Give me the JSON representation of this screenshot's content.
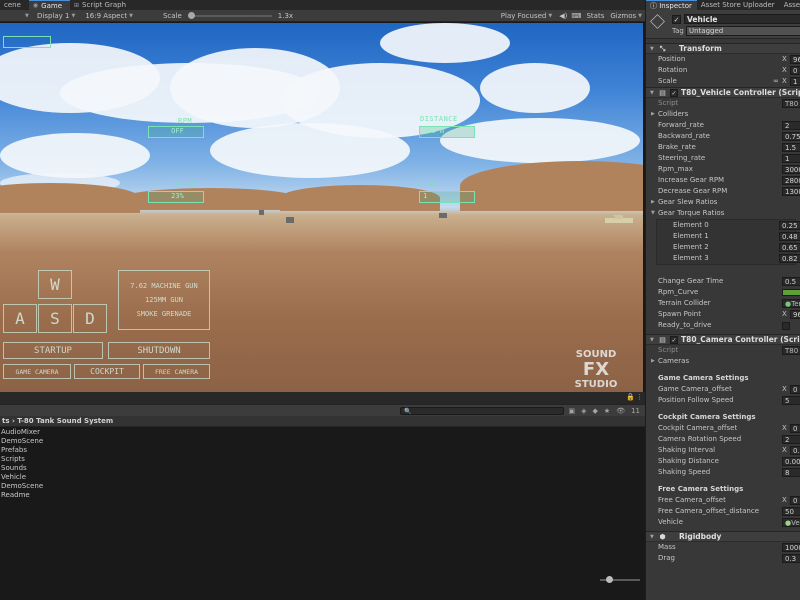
{
  "tabs": [
    {
      "label": "cene",
      "icon": "",
      "active": false
    },
    {
      "label": "Game",
      "icon": "game-icon",
      "active": true
    },
    {
      "label": "Script Graph",
      "icon": "script-graph-icon",
      "active": false
    }
  ],
  "game_toolbar": {
    "display": "Display 1",
    "aspect": "16:9 Aspect",
    "scale_label": "Scale",
    "scale_value": "1.3x",
    "play_mode": "Play Focused",
    "stats": "Stats",
    "gizmos": "Gizmos"
  },
  "hud": {
    "rpm_label": "RPM",
    "rpm_value": "OFF",
    "distance_label": "DISTANCE",
    "distance_value": "500 m",
    "speed_label": "SPEED",
    "speed_value": "23%",
    "gear_label": "GEAR",
    "gear_value": "1",
    "keys": {
      "w": "W",
      "a": "A",
      "s": "S",
      "d": "D"
    },
    "weapons": [
      "7.62 MACHINE GUN",
      "125MM GUN",
      "SMOKE GRENADE"
    ],
    "startup": "STARTUP",
    "shutdown": "SHUTDOWN",
    "cameras": [
      "GAME CAMERA",
      "COCKPIT",
      "FREE CAMERA"
    ],
    "logo_lines": [
      "SOUND",
      "FX",
      "STUDIO"
    ]
  },
  "project": {
    "breadcrumb": "ts › T-80 Tank Sound System",
    "search_placeholder": "",
    "count": "11",
    "items": [
      "AudioMixer",
      "DemoScene",
      "Prefabs",
      "Scripts",
      "Sounds",
      "Vehicle",
      "DemoScene",
      "Readme"
    ]
  },
  "inspector": {
    "tabs": [
      "Inspector",
      "Asset Store Uploader",
      "Asset"
    ],
    "object_name": "Vehicle",
    "tag_label": "Tag",
    "tag_value": "Untagged",
    "transform": {
      "title": "Transform",
      "position_label": "Position",
      "position_x": "96",
      "rotation_label": "Rotation",
      "rotation_x": "0",
      "scale_label": "Scale",
      "scale_x": "1"
    },
    "vehicle_controller": {
      "title": "T80_Vehicle Controller (Script)",
      "script_label": "Script",
      "script_value": "T80",
      "colliders_label": "Colliders",
      "forward_rate_label": "Forward_rate",
      "forward_rate": "2",
      "backward_rate_label": "Backward_rate",
      "backward_rate": "0.75",
      "brake_rate_label": "Brake_rate",
      "brake_rate": "1.5",
      "steering_rate_label": "Steering_rate",
      "steering_rate": "1",
      "rpm_max_label": "Rpm_max",
      "rpm_max": "3000",
      "increase_rpm_label": "Increase Gear RPM",
      "increase_rpm": "2800",
      "decrease_rpm_label": "Decrease Gear RPM",
      "decrease_rpm": "1300",
      "gear_slew_label": "Gear Slew Ratios",
      "gear_torque_label": "Gear Torque Ratios",
      "elements": [
        {
          "label": "Element 0",
          "value": "0.25"
        },
        {
          "label": "Element 1",
          "value": "0.48"
        },
        {
          "label": "Element 2",
          "value": "0.65"
        },
        {
          "label": "Element 3",
          "value": "0.82"
        }
      ],
      "change_gear_time_label": "Change Gear Time",
      "change_gear_time": "0.5",
      "rpm_curve_label": "Rpm_Curve",
      "terrain_collider_label": "Terrain Collider",
      "terrain_collider": "Terr",
      "spawn_point_label": "Spawn Point",
      "spawn_point": "96",
      "ready_label": "Ready_to_drive"
    },
    "camera_controller": {
      "title": "T80_Camera Controller (Script)",
      "script_label": "Script",
      "script_value": "T80",
      "cameras_label": "Cameras",
      "game_settings_label": "Game Camera Settings",
      "game_offset_label": "Game Camera_offset",
      "game_offset_x": "0",
      "follow_speed_label": "Position Follow Speed",
      "follow_speed": "5",
      "cockpit_settings_label": "Cockpit Camera Settings",
      "cockpit_offset_label": "Cockpit Camera_offset",
      "cockpit_offset_x": "0",
      "rotation_speed_label": "Camera Rotation Speed",
      "rotation_speed": "2",
      "shaking_interval_label": "Shaking Interval",
      "shaking_interval_x": "0.0",
      "shaking_distance_label": "Shaking Distance",
      "shaking_distance": "0.001",
      "shaking_speed_label": "Shaking Speed",
      "shaking_speed": "8",
      "free_settings_label": "Free Camera Settings",
      "free_offset_label": "Free Camera_offset",
      "free_offset_x": "0",
      "free_distance_label": "Free Camera_offset_distance",
      "free_distance": "50",
      "vehicle_label": "Vehicle",
      "vehicle_value": "Vehi"
    },
    "rigidbody": {
      "title": "Rigidbody",
      "mass_label": "Mass",
      "mass": "1000",
      "drag_label": "Drag",
      "drag": "0.3"
    }
  }
}
